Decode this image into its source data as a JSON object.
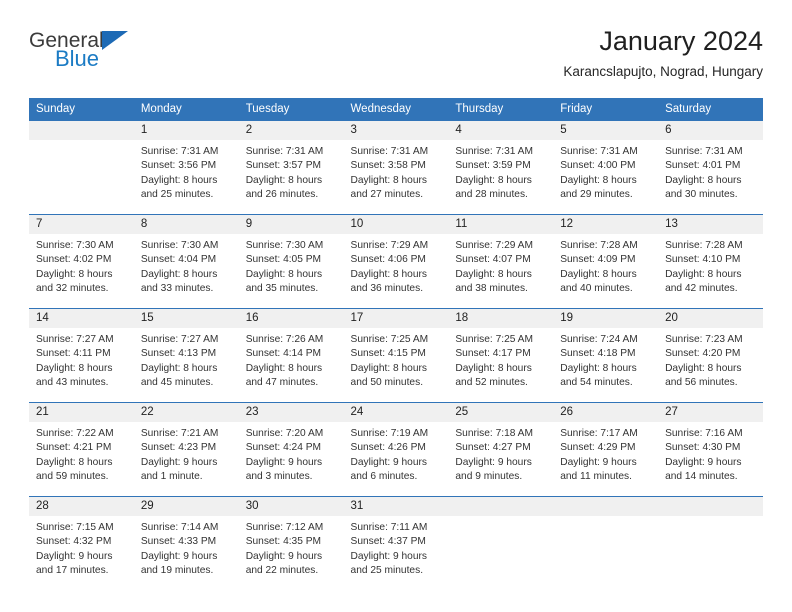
{
  "brand": {
    "name_part1": "General",
    "name_part2": "Blue",
    "logo_icon": "triangle-logo-icon"
  },
  "header": {
    "title": "January 2024",
    "subtitle": "Karancslapujto, Nograd, Hungary"
  },
  "calendar": {
    "weekday_headers": [
      "Sunday",
      "Monday",
      "Tuesday",
      "Wednesday",
      "Thursday",
      "Friday",
      "Saturday"
    ],
    "accent_color": "#3174b8",
    "daynum_bg": "#f0f0f0",
    "weeks": [
      [
        {
          "day": "",
          "sunrise": "",
          "sunset": "",
          "daylight_line1": "",
          "daylight_line2": ""
        },
        {
          "day": "1",
          "sunrise": "Sunrise: 7:31 AM",
          "sunset": "Sunset: 3:56 PM",
          "daylight_line1": "Daylight: 8 hours",
          "daylight_line2": "and 25 minutes."
        },
        {
          "day": "2",
          "sunrise": "Sunrise: 7:31 AM",
          "sunset": "Sunset: 3:57 PM",
          "daylight_line1": "Daylight: 8 hours",
          "daylight_line2": "and 26 minutes."
        },
        {
          "day": "3",
          "sunrise": "Sunrise: 7:31 AM",
          "sunset": "Sunset: 3:58 PM",
          "daylight_line1": "Daylight: 8 hours",
          "daylight_line2": "and 27 minutes."
        },
        {
          "day": "4",
          "sunrise": "Sunrise: 7:31 AM",
          "sunset": "Sunset: 3:59 PM",
          "daylight_line1": "Daylight: 8 hours",
          "daylight_line2": "and 28 minutes."
        },
        {
          "day": "5",
          "sunrise": "Sunrise: 7:31 AM",
          "sunset": "Sunset: 4:00 PM",
          "daylight_line1": "Daylight: 8 hours",
          "daylight_line2": "and 29 minutes."
        },
        {
          "day": "6",
          "sunrise": "Sunrise: 7:31 AM",
          "sunset": "Sunset: 4:01 PM",
          "daylight_line1": "Daylight: 8 hours",
          "daylight_line2": "and 30 minutes."
        }
      ],
      [
        {
          "day": "7",
          "sunrise": "Sunrise: 7:30 AM",
          "sunset": "Sunset: 4:02 PM",
          "daylight_line1": "Daylight: 8 hours",
          "daylight_line2": "and 32 minutes."
        },
        {
          "day": "8",
          "sunrise": "Sunrise: 7:30 AM",
          "sunset": "Sunset: 4:04 PM",
          "daylight_line1": "Daylight: 8 hours",
          "daylight_line2": "and 33 minutes."
        },
        {
          "day": "9",
          "sunrise": "Sunrise: 7:30 AM",
          "sunset": "Sunset: 4:05 PM",
          "daylight_line1": "Daylight: 8 hours",
          "daylight_line2": "and 35 minutes."
        },
        {
          "day": "10",
          "sunrise": "Sunrise: 7:29 AM",
          "sunset": "Sunset: 4:06 PM",
          "daylight_line1": "Daylight: 8 hours",
          "daylight_line2": "and 36 minutes."
        },
        {
          "day": "11",
          "sunrise": "Sunrise: 7:29 AM",
          "sunset": "Sunset: 4:07 PM",
          "daylight_line1": "Daylight: 8 hours",
          "daylight_line2": "and 38 minutes."
        },
        {
          "day": "12",
          "sunrise": "Sunrise: 7:28 AM",
          "sunset": "Sunset: 4:09 PM",
          "daylight_line1": "Daylight: 8 hours",
          "daylight_line2": "and 40 minutes."
        },
        {
          "day": "13",
          "sunrise": "Sunrise: 7:28 AM",
          "sunset": "Sunset: 4:10 PM",
          "daylight_line1": "Daylight: 8 hours",
          "daylight_line2": "and 42 minutes."
        }
      ],
      [
        {
          "day": "14",
          "sunrise": "Sunrise: 7:27 AM",
          "sunset": "Sunset: 4:11 PM",
          "daylight_line1": "Daylight: 8 hours",
          "daylight_line2": "and 43 minutes."
        },
        {
          "day": "15",
          "sunrise": "Sunrise: 7:27 AM",
          "sunset": "Sunset: 4:13 PM",
          "daylight_line1": "Daylight: 8 hours",
          "daylight_line2": "and 45 minutes."
        },
        {
          "day": "16",
          "sunrise": "Sunrise: 7:26 AM",
          "sunset": "Sunset: 4:14 PM",
          "daylight_line1": "Daylight: 8 hours",
          "daylight_line2": "and 47 minutes."
        },
        {
          "day": "17",
          "sunrise": "Sunrise: 7:25 AM",
          "sunset": "Sunset: 4:15 PM",
          "daylight_line1": "Daylight: 8 hours",
          "daylight_line2": "and 50 minutes."
        },
        {
          "day": "18",
          "sunrise": "Sunrise: 7:25 AM",
          "sunset": "Sunset: 4:17 PM",
          "daylight_line1": "Daylight: 8 hours",
          "daylight_line2": "and 52 minutes."
        },
        {
          "day": "19",
          "sunrise": "Sunrise: 7:24 AM",
          "sunset": "Sunset: 4:18 PM",
          "daylight_line1": "Daylight: 8 hours",
          "daylight_line2": "and 54 minutes."
        },
        {
          "day": "20",
          "sunrise": "Sunrise: 7:23 AM",
          "sunset": "Sunset: 4:20 PM",
          "daylight_line1": "Daylight: 8 hours",
          "daylight_line2": "and 56 minutes."
        }
      ],
      [
        {
          "day": "21",
          "sunrise": "Sunrise: 7:22 AM",
          "sunset": "Sunset: 4:21 PM",
          "daylight_line1": "Daylight: 8 hours",
          "daylight_line2": "and 59 minutes."
        },
        {
          "day": "22",
          "sunrise": "Sunrise: 7:21 AM",
          "sunset": "Sunset: 4:23 PM",
          "daylight_line1": "Daylight: 9 hours",
          "daylight_line2": "and 1 minute."
        },
        {
          "day": "23",
          "sunrise": "Sunrise: 7:20 AM",
          "sunset": "Sunset: 4:24 PM",
          "daylight_line1": "Daylight: 9 hours",
          "daylight_line2": "and 3 minutes."
        },
        {
          "day": "24",
          "sunrise": "Sunrise: 7:19 AM",
          "sunset": "Sunset: 4:26 PM",
          "daylight_line1": "Daylight: 9 hours",
          "daylight_line2": "and 6 minutes."
        },
        {
          "day": "25",
          "sunrise": "Sunrise: 7:18 AM",
          "sunset": "Sunset: 4:27 PM",
          "daylight_line1": "Daylight: 9 hours",
          "daylight_line2": "and 9 minutes."
        },
        {
          "day": "26",
          "sunrise": "Sunrise: 7:17 AM",
          "sunset": "Sunset: 4:29 PM",
          "daylight_line1": "Daylight: 9 hours",
          "daylight_line2": "and 11 minutes."
        },
        {
          "day": "27",
          "sunrise": "Sunrise: 7:16 AM",
          "sunset": "Sunset: 4:30 PM",
          "daylight_line1": "Daylight: 9 hours",
          "daylight_line2": "and 14 minutes."
        }
      ],
      [
        {
          "day": "28",
          "sunrise": "Sunrise: 7:15 AM",
          "sunset": "Sunset: 4:32 PM",
          "daylight_line1": "Daylight: 9 hours",
          "daylight_line2": "and 17 minutes."
        },
        {
          "day": "29",
          "sunrise": "Sunrise: 7:14 AM",
          "sunset": "Sunset: 4:33 PM",
          "daylight_line1": "Daylight: 9 hours",
          "daylight_line2": "and 19 minutes."
        },
        {
          "day": "30",
          "sunrise": "Sunrise: 7:12 AM",
          "sunset": "Sunset: 4:35 PM",
          "daylight_line1": "Daylight: 9 hours",
          "daylight_line2": "and 22 minutes."
        },
        {
          "day": "31",
          "sunrise": "Sunrise: 7:11 AM",
          "sunset": "Sunset: 4:37 PM",
          "daylight_line1": "Daylight: 9 hours",
          "daylight_line2": "and 25 minutes."
        },
        {
          "day": "",
          "sunrise": "",
          "sunset": "",
          "daylight_line1": "",
          "daylight_line2": ""
        },
        {
          "day": "",
          "sunrise": "",
          "sunset": "",
          "daylight_line1": "",
          "daylight_line2": ""
        },
        {
          "day": "",
          "sunrise": "",
          "sunset": "",
          "daylight_line1": "",
          "daylight_line2": ""
        }
      ]
    ]
  }
}
